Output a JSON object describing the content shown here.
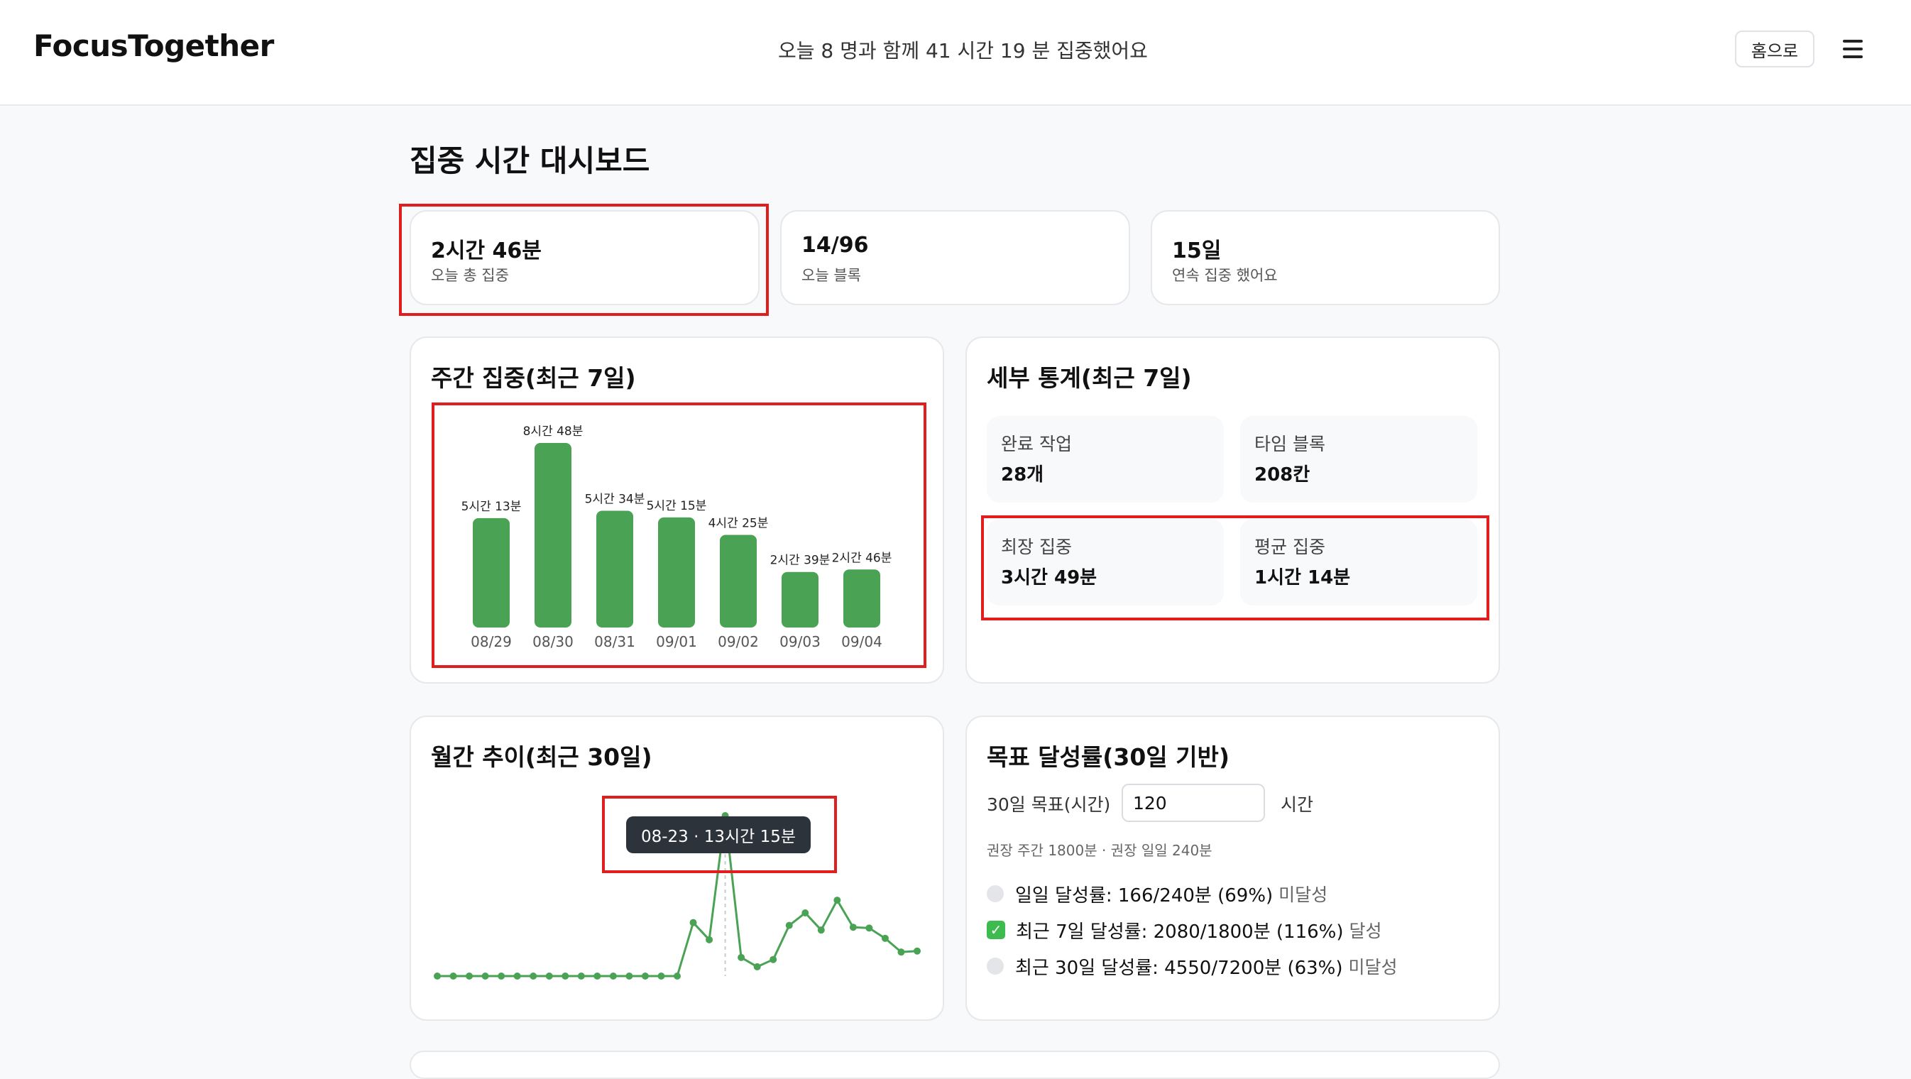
{
  "header": {
    "brand": "FocusTogether",
    "stat_text": "오늘 8 명과 함께 41 시간 19 분 집중했어요",
    "home_label": "홈으로",
    "menu_icon": "hamburger-menu-icon"
  },
  "page": {
    "title": "집중 시간 대시보드"
  },
  "summary": [
    {
      "value": "2시간 46분",
      "label": "오늘 총 집중"
    },
    {
      "value": "14/96",
      "label": "오늘 블록"
    },
    {
      "value": "15일",
      "label": "연속 집중 했어요"
    }
  ],
  "weekly": {
    "title": "주간 집중(최근 7일)",
    "chart_data": {
      "type": "bar",
      "categories": [
        "08/29",
        "08/30",
        "08/31",
        "09/01",
        "09/02",
        "09/03",
        "09/04"
      ],
      "values_minutes": [
        313,
        528,
        334,
        315,
        265,
        159,
        166
      ],
      "data_labels": [
        "5시간 13분",
        "8시간 48분",
        "5시간 34분",
        "5시간 15분",
        "4시간 25분",
        "2시간 39분",
        "2시간 46분"
      ],
      "color": "#4aa354",
      "ylim": [
        0,
        528
      ]
    }
  },
  "details": {
    "title": "세부 통계(최근 7일)",
    "tiles": [
      {
        "label": "완료 작업",
        "value": "28개"
      },
      {
        "label": "타임 블록",
        "value": "208칸"
      },
      {
        "label": "최장 집중",
        "value": "3시간 49분"
      },
      {
        "label": "평균 집중",
        "value": "1시간 14분"
      }
    ]
  },
  "monthly": {
    "title": "월간 추이(최근 30일)",
    "tooltip": "08-23 · 13시간 15분",
    "chart_data": {
      "type": "line",
      "values_minutes": [
        0,
        0,
        0,
        0,
        0,
        0,
        0,
        0,
        0,
        0,
        0,
        0,
        0,
        0,
        0,
        0,
        265,
        180,
        795,
        92,
        46,
        82,
        251,
        313,
        228,
        376,
        242,
        238,
        187,
        119,
        124
      ],
      "highlight_index": 18,
      "color": "#4aa354"
    }
  },
  "goal": {
    "title": "목표 달성률(30일 기반)",
    "input_label": "30일 목표(시간)",
    "input_value": "120",
    "unit": "시간",
    "hint": "권장 주간 1800분 · 권장 일일 240분",
    "rows": [
      {
        "text": "일일 달성률: 166/240분 (69%)",
        "status": "미달성",
        "achieved": false
      },
      {
        "text": "최근 7일 달성률: 2080/1800분 (116%)",
        "status": "달성",
        "achieved": true
      },
      {
        "text": "최근 30일 달성률: 4550/7200분 (63%)",
        "status": "미달성",
        "achieved": false
      }
    ]
  }
}
